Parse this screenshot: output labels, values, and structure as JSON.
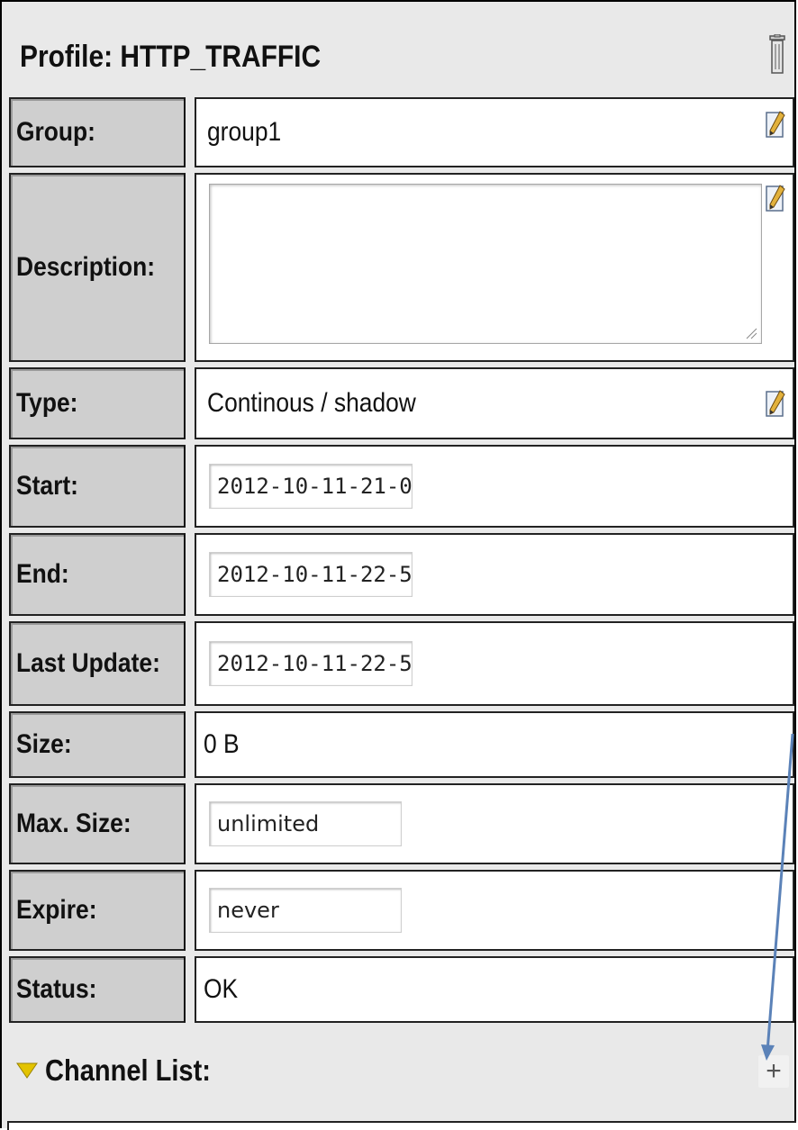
{
  "profile": {
    "title": "Profile:  HTTP_TRAFFIC"
  },
  "fields": {
    "group": {
      "label": "Group:",
      "value": "group1"
    },
    "description": {
      "label": "Description:",
      "value": ""
    },
    "type": {
      "label": "Type:",
      "value": "Continous / shadow"
    },
    "start": {
      "label": "Start:",
      "value": "2012-10-11-21-0"
    },
    "end": {
      "label": "End:",
      "value": "2012-10-11-22-5"
    },
    "last_update": {
      "label": "Last Update:",
      "value": "2012-10-11-22-5"
    },
    "size": {
      "label": "Size:",
      "value": "0 B"
    },
    "max_size": {
      "label": "Max. Size:",
      "value": "unlimited"
    },
    "expire": {
      "label": "Expire:",
      "value": "never"
    },
    "status": {
      "label": "Status:",
      "value": "OK"
    }
  },
  "channel_list": {
    "label": "Channel List:",
    "add_label": "+"
  },
  "icons": {
    "delete": "trash-icon",
    "edit": "pencil-icon",
    "expand": "triangle-down-icon",
    "add": "plus-icon"
  },
  "colors": {
    "panel_bg": "#e9e9e9",
    "label_bg": "#cfcfcf",
    "value_bg": "#ffffff",
    "annotation_arrow": "#5b82b8",
    "expand_triangle": "#e3c300"
  }
}
